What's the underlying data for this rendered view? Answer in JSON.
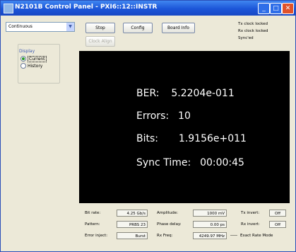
{
  "window": {
    "title": "N2101B Control Panel - PXI6::12::INSTR"
  },
  "mode_select": {
    "value": "Continuous"
  },
  "toolbar": {
    "stop_label": "Stop",
    "config_label": "Config",
    "board_info_label": "Board Info",
    "clock_align_label": "Clock Align"
  },
  "status": {
    "tx": "Tx clock locked",
    "rx": "Rx clock locked",
    "sync": "Sync'ed"
  },
  "display": {
    "label": "Display",
    "options": [
      "Current",
      "History"
    ],
    "selected": "Current"
  },
  "results": {
    "ber_label": "BER:",
    "ber_value": "5.2204e-011",
    "errors_label": "Errors:",
    "errors_value": "10",
    "bits_label": "Bits:",
    "bits_value": "1.9156e+011",
    "sync_label": "Sync Time:",
    "sync_value": "00:00:45"
  },
  "params": {
    "bit_rate_label": "Bit rate:",
    "bit_rate_value": "4.25 Gb/s",
    "pattern_label": "Pattern:",
    "pattern_value": "PRBS 23",
    "error_inject_label": "Error inject:",
    "error_inject_value": "Burst",
    "amplitude_label": "Amplitude:",
    "amplitude_value": "1000 mV",
    "phase_delay_label": "Phase delay:",
    "phase_delay_value": "0.00 ps",
    "rx_freq_label": "Rx Freq:",
    "rx_freq_value": "4249.97 MHz",
    "tx_invert_label": "Tx invert:",
    "tx_invert_value": "Off",
    "rx_invert_label": "Rx invert:",
    "rx_invert_value": "Off",
    "exact_rate_label": "Exact Rate Mode"
  }
}
